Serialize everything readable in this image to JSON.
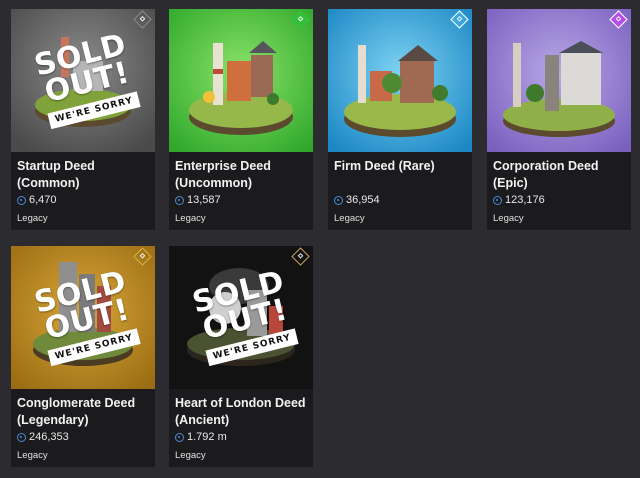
{
  "sold_out": {
    "line1": "SOLD",
    "line2": "OUT!",
    "banner": "WE'RE SORRY"
  },
  "cards": [
    {
      "title": "Startup Deed (Common)",
      "price": "6,470",
      "tag": "Legacy",
      "rarity_color": "#8a8a8a",
      "bg": "#5a5a5a",
      "sold_out": true
    },
    {
      "title": "Enterprise Deed (Uncommon)",
      "price": "13,587",
      "tag": "Legacy",
      "rarity_color": "#3cc43c",
      "bg": "#46c93b",
      "sold_out": false
    },
    {
      "title": "Firm Deed (Rare)",
      "price": "36,954",
      "tag": "Legacy",
      "rarity_color": "#3aa7e0",
      "bg": "#2b9fd6",
      "sold_out": false
    },
    {
      "title": "Corporation Deed (Epic)",
      "price": "123,176",
      "tag": "Legacy",
      "rarity_color": "#a64fe0",
      "bg": "#8f72c9",
      "sold_out": false
    },
    {
      "title": "Conglomerate Deed (Legendary)",
      "price": "246,353",
      "tag": "Legacy",
      "rarity_color": "#c99a1e",
      "bg": "#b98a1c",
      "sold_out": true
    },
    {
      "title": "Heart of London Deed (Ancient)",
      "price": "1.792 m",
      "tag": "Legacy",
      "rarity_color": "#c8a060",
      "bg": "#141414",
      "sold_out": true
    }
  ]
}
